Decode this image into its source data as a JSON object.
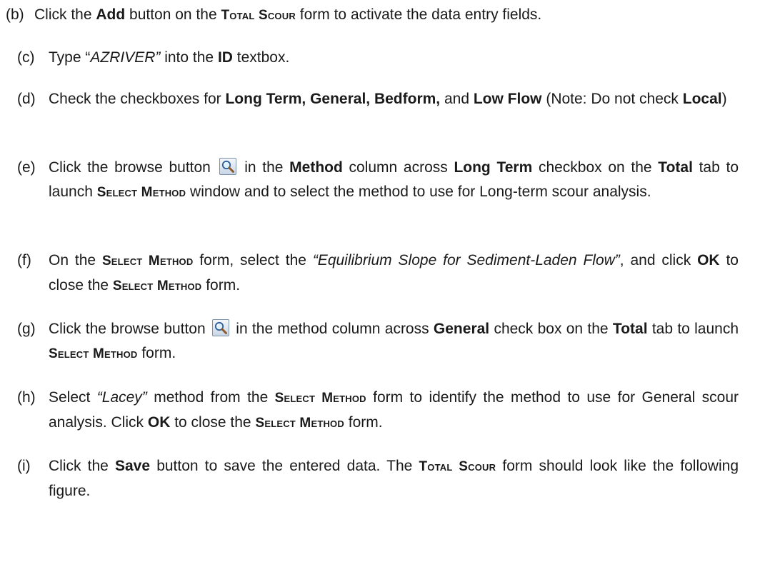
{
  "steps": [
    {
      "label": "(b)",
      "segments": [
        {
          "t": "Click the ",
          "s": "n"
        },
        {
          "t": "Add",
          "s": "b"
        },
        {
          "t": " button on the ",
          "s": "n"
        },
        {
          "t": "Total Scour",
          "s": "sc"
        },
        {
          "t": " form to activate the data entry fields.",
          "s": "n"
        }
      ]
    },
    {
      "label": "(c)",
      "segments": [
        {
          "t": "Type “",
          "s": "n"
        },
        {
          "t": "AZRIVER”",
          "s": "i"
        },
        {
          "t": " into the ",
          "s": "n"
        },
        {
          "t": "ID",
          "s": "b"
        },
        {
          "t": " textbox.",
          "s": "n"
        }
      ]
    },
    {
      "label": "(d)",
      "segments": [
        {
          "t": "Check the checkboxes for ",
          "s": "n"
        },
        {
          "t": "Long Term, General, Bedform,",
          "s": "b"
        },
        {
          "t": " and ",
          "s": "n"
        },
        {
          "t": "Low Flow",
          "s": "b"
        },
        {
          "t": " (Note: Do not check ",
          "s": "n"
        },
        {
          "t": "Local",
          "s": "b"
        },
        {
          "t": ")",
          "s": "n"
        }
      ]
    },
    {
      "label": "(e)",
      "segments": [
        {
          "t": "Click the browse button ",
          "s": "n"
        },
        {
          "t": "browse-magnifier-icon",
          "s": "icon"
        },
        {
          "t": " in the ",
          "s": "n"
        },
        {
          "t": "Method",
          "s": "b"
        },
        {
          "t": " column across ",
          "s": "n"
        },
        {
          "t": "Long Term",
          "s": "b"
        },
        {
          "t": " checkbox on the ",
          "s": "n"
        },
        {
          "t": "Total",
          "s": "b"
        },
        {
          "t": " tab to launch ",
          "s": "n"
        },
        {
          "t": "Select Method",
          "s": "sc"
        },
        {
          "t": " window and to select the method to use for Long-term scour analysis.",
          "s": "n"
        }
      ]
    },
    {
      "label": "(f)",
      "segments": [
        {
          "t": "On the ",
          "s": "n"
        },
        {
          "t": "Select Method",
          "s": "sc"
        },
        {
          "t": " form, select the ",
          "s": "n"
        },
        {
          "t": "“Equilibrium Slope for Sediment-Laden Flow”",
          "s": "i"
        },
        {
          "t": ", and click ",
          "s": "n"
        },
        {
          "t": "OK",
          "s": "b"
        },
        {
          "t": " to close the ",
          "s": "n"
        },
        {
          "t": "Select Method",
          "s": "sc"
        },
        {
          "t": " form.",
          "s": "n"
        }
      ]
    },
    {
      "label": "(g)",
      "segments": [
        {
          "t": "Click the browse button ",
          "s": "n"
        },
        {
          "t": "browse-magnifier-icon",
          "s": "icon"
        },
        {
          "t": " in the method column across ",
          "s": "n"
        },
        {
          "t": "General",
          "s": "b"
        },
        {
          "t": " check box on the ",
          "s": "n"
        },
        {
          "t": "Total",
          "s": "b"
        },
        {
          "t": " tab to launch ",
          "s": "n"
        },
        {
          "t": "Select Method",
          "s": "sc"
        },
        {
          "t": " form.",
          "s": "n"
        }
      ]
    },
    {
      "label": "(h)",
      "segments": [
        {
          "t": "Select ",
          "s": "n"
        },
        {
          "t": "“Lacey”",
          "s": "i"
        },
        {
          "t": " method from the ",
          "s": "n"
        },
        {
          "t": "Select Method",
          "s": "sc"
        },
        {
          "t": " form to identify the method to use for General scour analysis. Click ",
          "s": "n"
        },
        {
          "t": "OK",
          "s": "b"
        },
        {
          "t": " to close the ",
          "s": "n"
        },
        {
          "t": "Select Method",
          "s": "sc"
        },
        {
          "t": " form.",
          "s": "n"
        }
      ]
    },
    {
      "label": "(i)",
      "segments": [
        {
          "t": "Click the ",
          "s": "n"
        },
        {
          "t": "Save",
          "s": "b"
        },
        {
          "t": " button to save the entered data. The ",
          "s": "n"
        },
        {
          "t": "Total Scour",
          "s": "sc"
        },
        {
          "t": " form should look like the following figure.",
          "s": "n"
        }
      ]
    }
  ]
}
